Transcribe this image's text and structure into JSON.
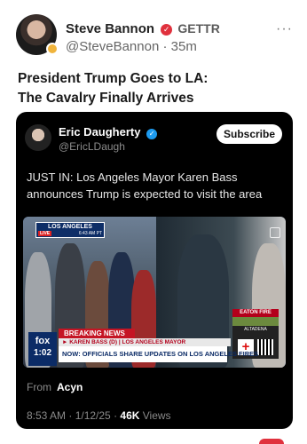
{
  "post": {
    "author_name": "Steve Bannon",
    "platform": "GETTR",
    "handle": "@SteveBannon",
    "time": " · 35m",
    "more": "···",
    "title_line1": "President Trump Goes to LA:",
    "title_line2": "The Cavalry Finally Arrives"
  },
  "embed": {
    "author_name": "Eric Daugherty",
    "handle": "@EricLDaugh",
    "subscribe_label": "Subscribe",
    "text": "JUST IN: Los Angeles Mayor Karen Bass announces Trump is expected to visit the area",
    "video": {
      "location": "LOS ANGELES",
      "live": "LIVE",
      "time": "6:43 AM PT",
      "breaking": "BREAKING NEWS",
      "speaker": "► KAREN BASS (D) | LOS ANGELES MAYOR",
      "headline": "NOW: OFFICIALS SHARE UPDATES ON LOS ANGELES FIRES",
      "network": "fox",
      "network_time": "1:02",
      "eaton_title": "EATON FIRE",
      "eaton_city": "ALTADENA"
    },
    "from_label": "From",
    "from_source": "Acyn",
    "timestamp": "8:53 AM · 1/12/25 · ",
    "views_count": "46K",
    "views_label": " Views"
  },
  "colors": {
    "verified_red": "#e0313d",
    "verified_blue": "#1d9bf0",
    "fox_navy": "#0b2b66",
    "breaking_red": "#c51524"
  }
}
